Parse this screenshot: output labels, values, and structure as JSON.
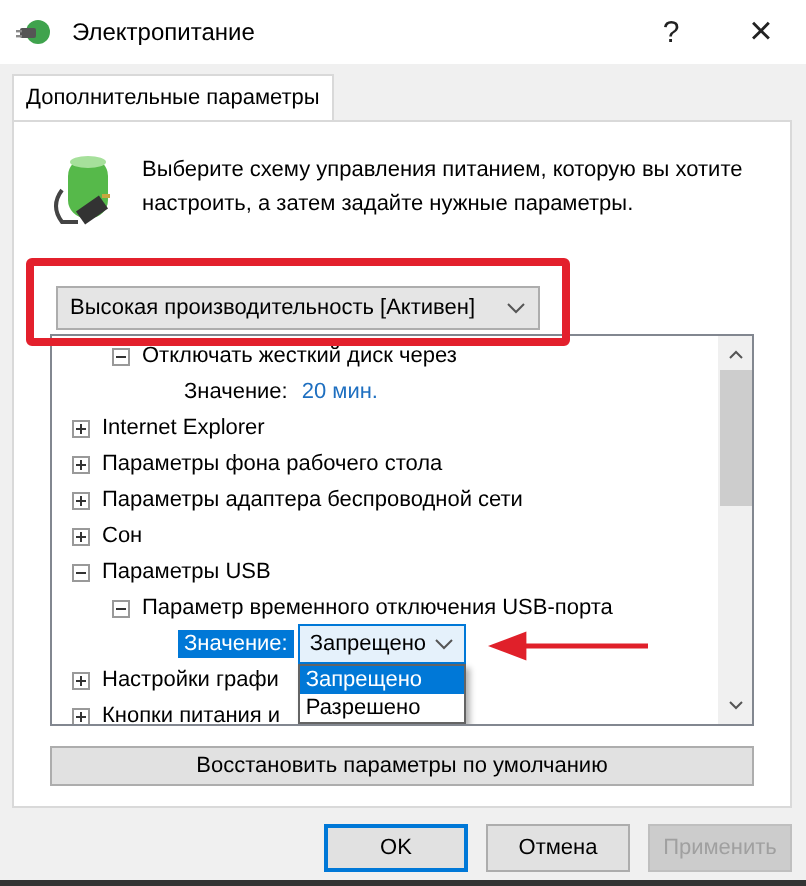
{
  "window": {
    "title": "Электропитание",
    "help": "?",
    "close": "×"
  },
  "tabs": [
    {
      "label": "Дополнительные параметры",
      "selected": true
    }
  ],
  "description": "Выберите схему управления питанием, которую вы хотите настроить, а затем задайте нужные параметры.",
  "plan": {
    "value": "Высокая производительность [Активен]",
    "highlighted": true
  },
  "tree": [
    {
      "kind": "setting",
      "label": "Отключать жесткий диск через",
      "expanded": true,
      "children": [
        {
          "kind": "value",
          "label": "Значение:",
          "value": "20 мин.",
          "selected": false
        }
      ]
    },
    {
      "kind": "category",
      "label": "Internet Explorer",
      "expanded": false
    },
    {
      "kind": "category",
      "label": "Параметры фона рабочего стола",
      "expanded": false
    },
    {
      "kind": "category",
      "label": "Параметры адаптера беспроводной сети",
      "expanded": false
    },
    {
      "kind": "category",
      "label": "Сон",
      "expanded": false
    },
    {
      "kind": "category",
      "label": "Параметры USB",
      "expanded": true,
      "children": [
        {
          "kind": "setting",
          "label": "Параметр временного отключения USB-порта",
          "expanded": true,
          "children": [
            {
              "kind": "value",
              "label": "Значение:",
              "selected": true,
              "dropdown": {
                "value": "Запрещено",
                "open": true,
                "options": [
                  {
                    "label": "Запрещено",
                    "selected": true
                  },
                  {
                    "label": "Разрешено",
                    "selected": false
                  }
                ]
              }
            }
          ]
        }
      ]
    },
    {
      "kind": "category",
      "label": "Настройки графи",
      "expanded": false
    },
    {
      "kind": "category",
      "label": "Кнопки питания и",
      "expanded": false
    }
  ],
  "restore_button": "Восстановить параметры по умолчанию",
  "buttons": [
    {
      "label": "OK",
      "default": true,
      "disabled": false
    },
    {
      "label": "Отмена",
      "default": false,
      "disabled": false
    },
    {
      "label": "Применить",
      "default": false,
      "disabled": true
    }
  ]
}
